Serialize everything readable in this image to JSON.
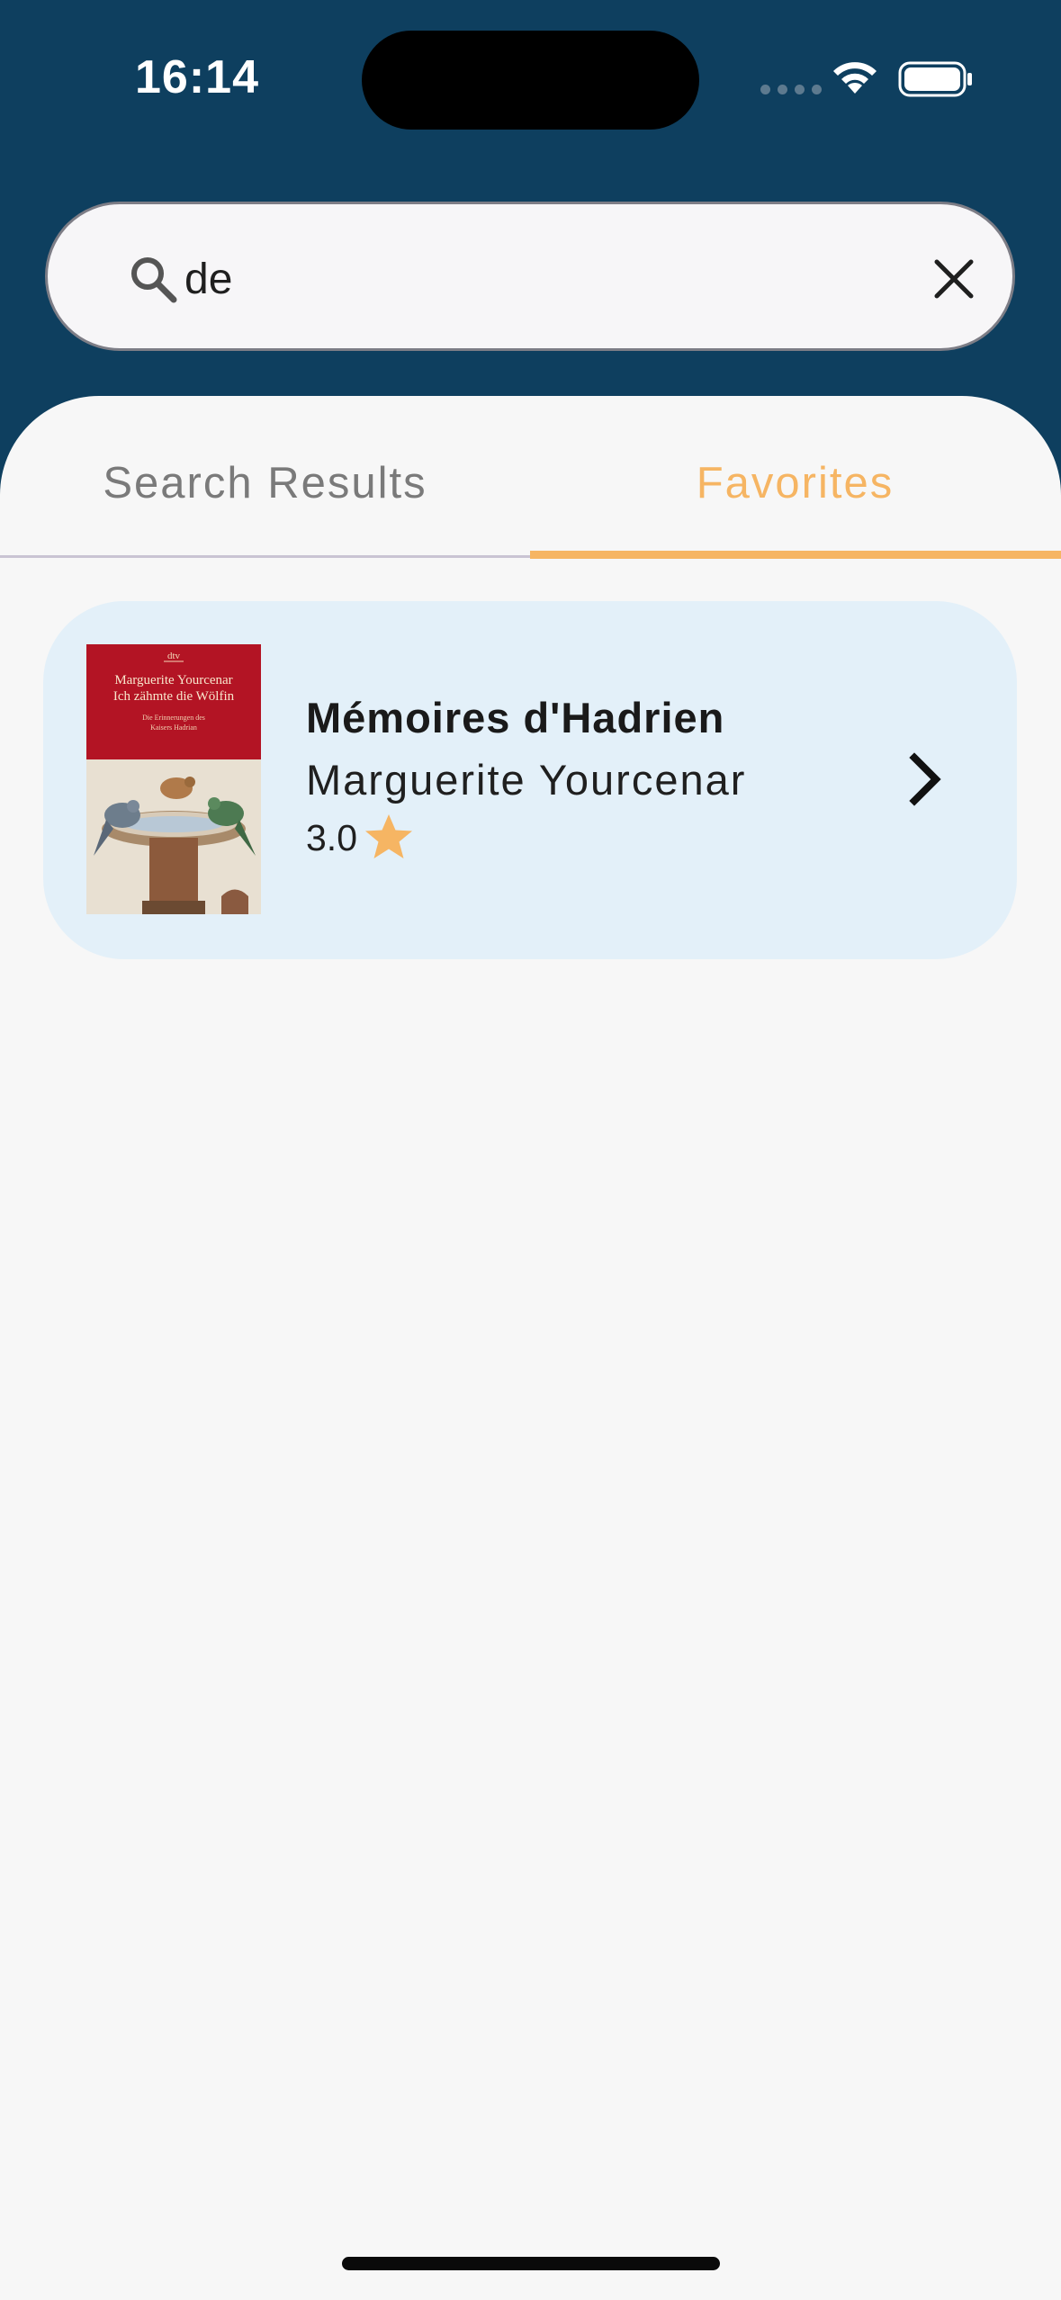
{
  "status_bar": {
    "time": "16:14"
  },
  "search": {
    "query": "de"
  },
  "tabs": [
    {
      "label": "Search Results",
      "selected": false
    },
    {
      "label": "Favorites",
      "selected": true
    }
  ],
  "favorites": [
    {
      "title": "Mémoires d'Hadrien",
      "author": "Marguerite Yourcenar",
      "rating": "3.0",
      "cover": {
        "publisher": "dtv",
        "author": "Marguerite Yourcenar",
        "title": "Ich zähmte die Wölfin",
        "subtitle_line1": "Die Erinnerungen des",
        "subtitle_line2": "Kaisers Hadrian"
      }
    }
  ],
  "colors": {
    "header_bg": "#0e3f5f",
    "accent": "#f6b563",
    "card_bg": "#e3f0f9",
    "sheet_bg": "#f7f7f7"
  },
  "icons": {
    "search": "search-icon",
    "clear": "close-icon",
    "rating": "star-icon",
    "open": "chevron-right-icon"
  }
}
